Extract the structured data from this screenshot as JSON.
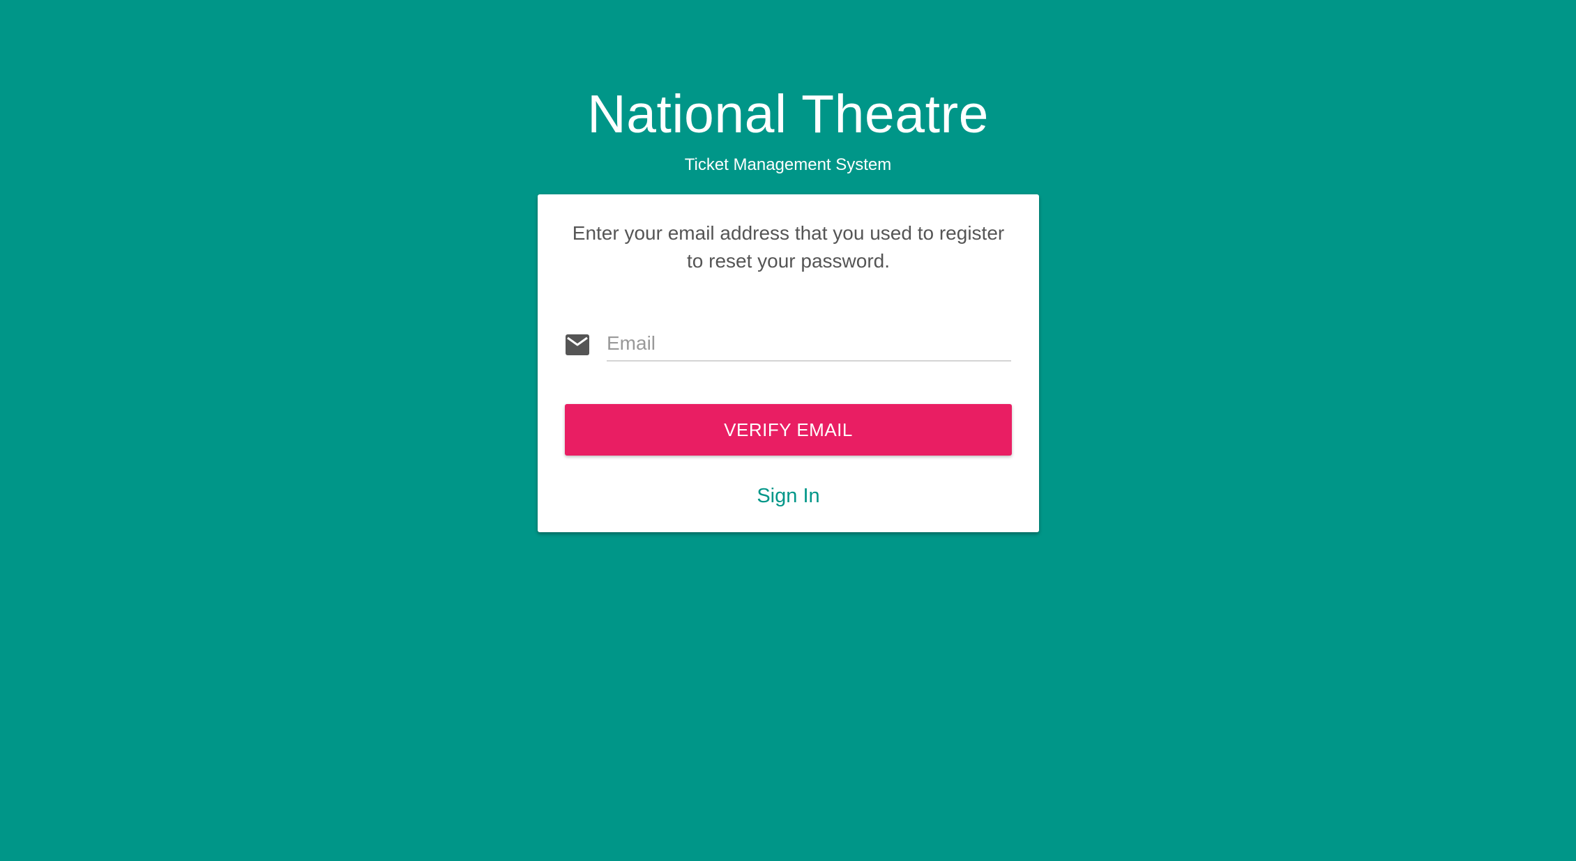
{
  "brand": {
    "title": "National Theatre",
    "subtitle": "Ticket Management System"
  },
  "reset_card": {
    "instruction": "Enter your email address that you used to register to reset your password.",
    "email_icon": "mail-icon",
    "email_placeholder": "Email",
    "email_value": "",
    "verify_label": "VERIFY EMAIL",
    "signin_label": "Sign In"
  },
  "colors": {
    "background": "#009688",
    "primary_button": "#e91e63",
    "link": "#009688",
    "card": "#ffffff"
  }
}
